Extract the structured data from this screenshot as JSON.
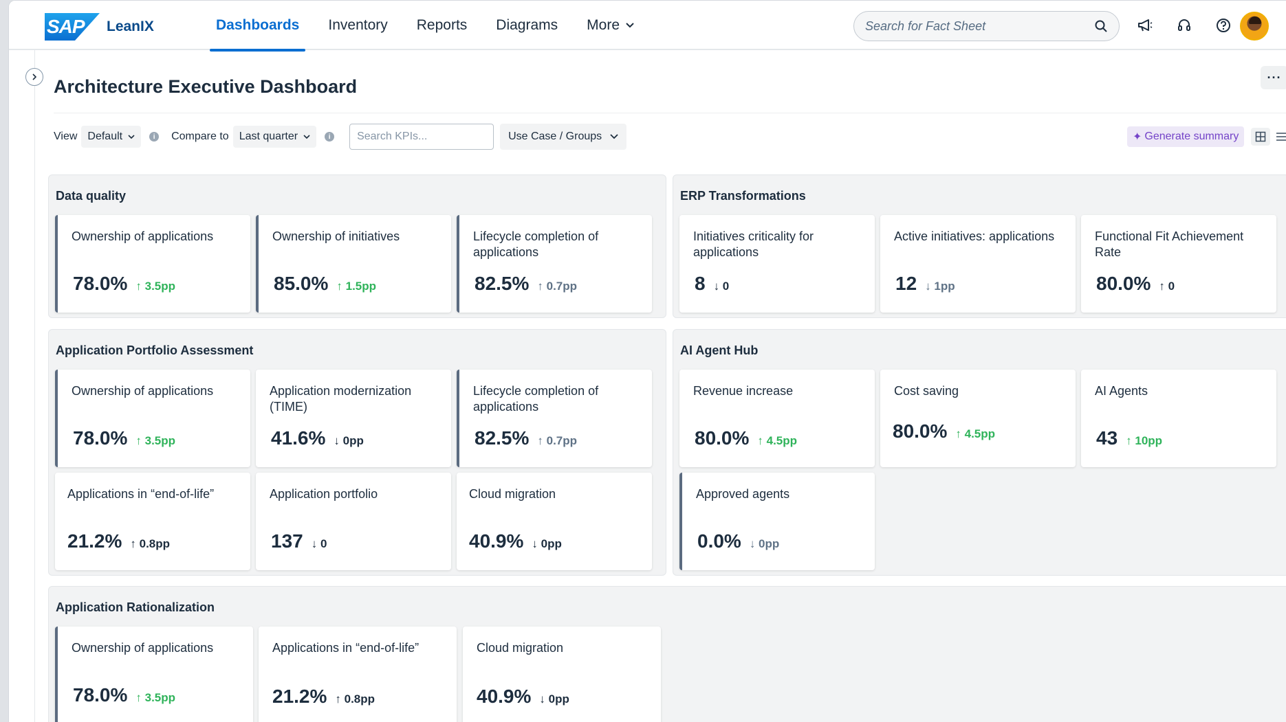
{
  "header": {
    "brand_logo": "SAP",
    "brand_name": "LeanIX",
    "nav": [
      {
        "label": "Dashboards",
        "active": true
      },
      {
        "label": "Inventory"
      },
      {
        "label": "Reports"
      },
      {
        "label": "Diagrams"
      },
      {
        "label": "More"
      }
    ],
    "search_placeholder": "Search for Fact Sheet",
    "icons": [
      "megaphone-icon",
      "headset-icon",
      "help-icon",
      "user-avatar"
    ]
  },
  "page": {
    "title": "Architecture Executive Dashboard",
    "more_label": "···"
  },
  "toolbar": {
    "view_label": "View",
    "view_value": "Default",
    "compare_label": "Compare to",
    "compare_value": "Last quarter",
    "kpi_search_placeholder": "Search KPIs...",
    "use_case_label": "Use Case / Groups",
    "generate_summary": "Generate summary"
  },
  "colors": {
    "accent": "#0a6ed1",
    "positive": "#2fb35a",
    "ai": "#7443c8",
    "neutral": "#5f7286"
  },
  "groups": {
    "data_quality": {
      "title": "Data quality",
      "cards": [
        {
          "title": "Ownership of applications",
          "value": "78.0%",
          "delta": "↑ 3.5pp"
        },
        {
          "title": "Ownership of initiatives",
          "value": "85.0%",
          "delta": "↑ 1.5pp"
        },
        {
          "title": "Lifecycle completion of applications",
          "value": "82.5%",
          "delta": "↑ 0.7pp"
        }
      ]
    },
    "erp": {
      "title": "ERP Transformations",
      "cards": [
        {
          "title": "Initiatives criticality for applications",
          "value": "8",
          "delta": "↓ 0"
        },
        {
          "title": "Active initiatives: applications",
          "value": "12",
          "delta": "↓ 1pp"
        },
        {
          "title": "Functional Fit Achievement Rate",
          "value": "80.0%",
          "delta": "↑ 0"
        }
      ]
    },
    "apa": {
      "title": "Application Portfolio Assessment",
      "cards": [
        {
          "title": "Ownership of applications",
          "value": "78.0%",
          "delta": "↑ 3.5pp"
        },
        {
          "title": "Application modernization (TIME)",
          "value": "41.6%",
          "delta": "↓ 0pp"
        },
        {
          "title": "Lifecycle completion of applications",
          "value": "82.5%",
          "delta": "↑ 0.7pp"
        },
        {
          "title": "Applications in “end-of-life”",
          "value": "21.2%",
          "delta": "↑ 0.8pp"
        },
        {
          "title": "Application portfolio",
          "value": "137",
          "delta": "↓ 0"
        },
        {
          "title": "Cloud migration",
          "value": "40.9%",
          "delta": "↓ 0pp"
        }
      ]
    },
    "ai": {
      "title": "AI Agent Hub",
      "cards": [
        {
          "title": "Revenue increase",
          "value": "80.0%",
          "delta": "↑ 4.5pp"
        },
        {
          "title": "Cost saving",
          "value": "80.0%",
          "delta": "↑ 4.5pp"
        },
        {
          "title": "AI Agents",
          "value": "43",
          "delta": "↑ 10pp"
        },
        {
          "title": "Approved agents",
          "value": "0.0%",
          "delta": "↓ 0pp"
        }
      ]
    },
    "rationalization": {
      "title": "Application Rationalization",
      "cards": [
        {
          "title": "Ownership of applications",
          "value": "78.0%",
          "delta": "↑ 3.5pp"
        },
        {
          "title": "Applications in “end-of-life”",
          "value": "21.2%",
          "delta": "↑ 0.8pp"
        },
        {
          "title": "Cloud migration",
          "value": "40.9%",
          "delta": "↓ 0pp"
        }
      ]
    }
  }
}
